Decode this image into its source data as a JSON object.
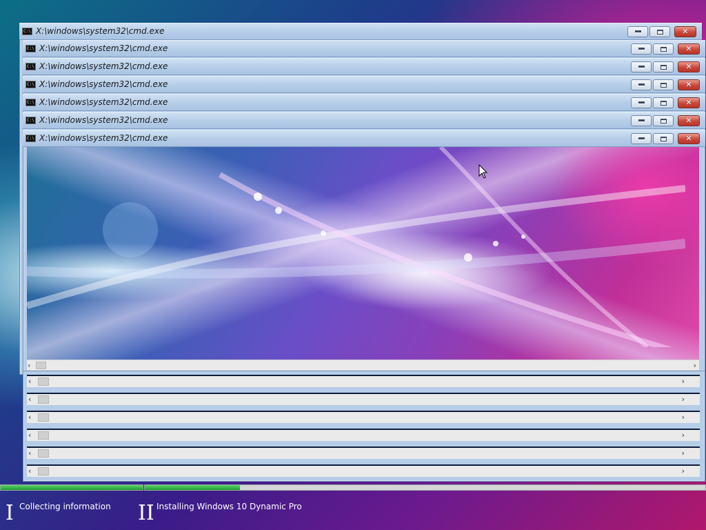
{
  "windows": [
    {
      "title": "X:\\windows\\system32\\cmd.exe"
    },
    {
      "title": "X:\\windows\\system32\\cmd.exe"
    },
    {
      "title": "X:\\windows\\system32\\cmd.exe"
    },
    {
      "title": "X:\\windows\\system32\\cmd.exe"
    },
    {
      "title": "X:\\windows\\system32\\cmd.exe"
    },
    {
      "title": "X:\\windows\\system32\\cmd.exe"
    },
    {
      "title": "X:\\windows\\system32\\cmd.exe"
    }
  ],
  "icons": {
    "window": "cmd-icon",
    "minimize": "minimize-icon",
    "maximize": "maximize-icon",
    "close": "close-icon",
    "scroll_left": "chevron-left-icon",
    "scroll_right": "chevron-right-icon"
  },
  "setup_progress": {
    "phases": [
      {
        "numeral": "I",
        "label": "Collecting information",
        "progress": 1.0
      },
      {
        "numeral": "II",
        "label": "Installing Windows 10 Dynamic Pro",
        "progress": 0.17
      }
    ]
  },
  "colors": {
    "progress_green": "#1e9a2e",
    "titlebar_blue": "#b5cde8",
    "close_red": "#c9473a"
  }
}
